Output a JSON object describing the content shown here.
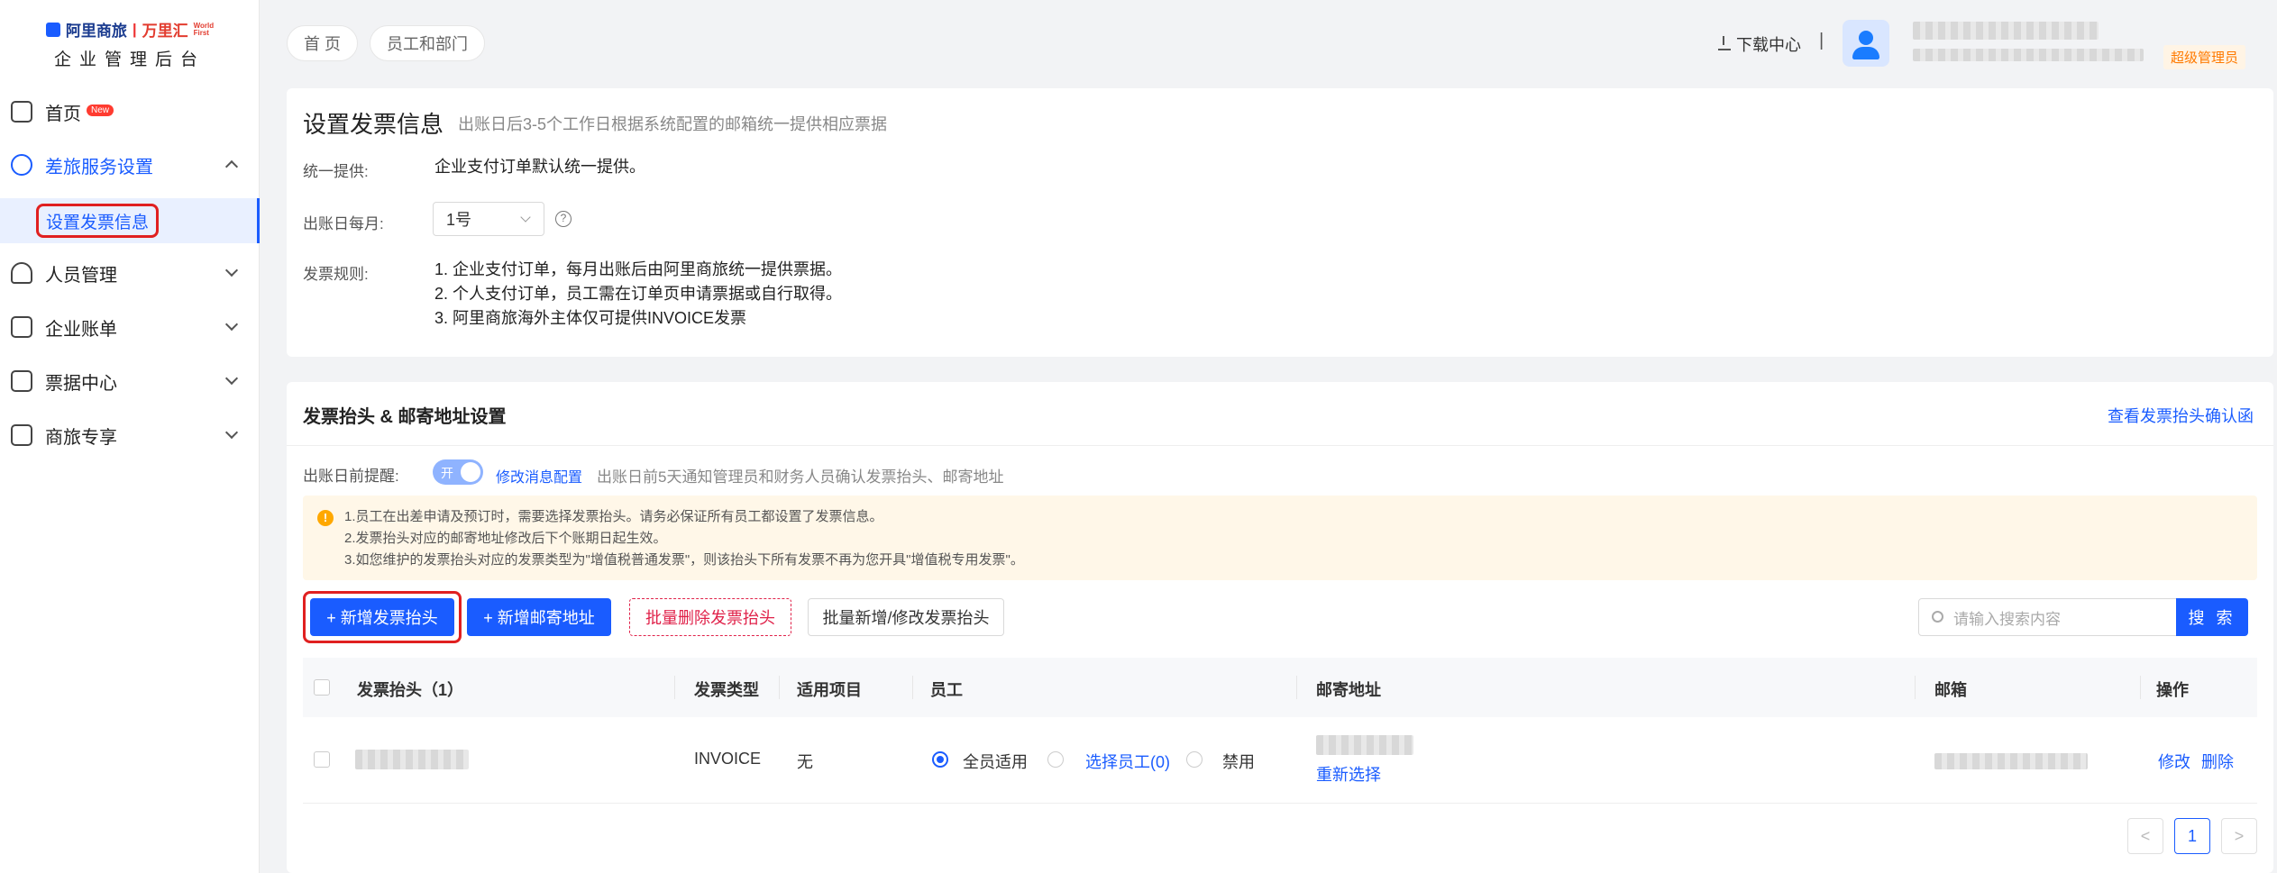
{
  "logo": {
    "brand1": "阿里商旅",
    "sep": "|",
    "brand2": "万里汇",
    "wf1": "World",
    "wf2": "First",
    "subtitle": "企业管理后台"
  },
  "sidebar": {
    "items": [
      {
        "label": "首页",
        "badge": "New"
      },
      {
        "label": "差旅服务设置",
        "sub": "设置发票信息"
      },
      {
        "label": "人员管理"
      },
      {
        "label": "企业账单"
      },
      {
        "label": "票据中心"
      },
      {
        "label": "商旅专享"
      }
    ]
  },
  "breadcrumb": [
    "首 页",
    "员工和部门"
  ],
  "header": {
    "download": "下载中心",
    "pipe": "|",
    "role": "超级管理员"
  },
  "invoice_info": {
    "title": "设置发票信息",
    "note": "出账日后3-5个工作日根据系统配置的邮箱统一提供相应票据",
    "unified_label": "统一提供:",
    "unified_value": "企业支付订单默认统一提供。",
    "billing_day_label": "出账日每月:",
    "billing_day_value": "1号",
    "help": "?",
    "rules_label": "发票规则:",
    "rules": [
      "1. 企业支付订单，每月出账后由阿里商旅统一提供票据。",
      "2. 个人支付订单，员工需在订单页申请票据或自行取得。",
      "3. 阿里商旅海外主体仅可提供INVOICE发票"
    ]
  },
  "header_setting": {
    "title": "发票抬头 & 邮寄地址设置",
    "confirm_link": "查看发票抬头确认函",
    "remind_label": "出账日前提醒:",
    "toggle_text": "开",
    "remind_link": "修改消息配置",
    "remind_note": "出账日前5天通知管理员和财务人员确认发票抬头、邮寄地址",
    "notice_icon": "!",
    "notices": [
      "1.员工在出差申请及预订时，需要选择发票抬头。请务必保证所有员工都设置了发票信息。",
      "2.发票抬头对应的邮寄地址修改后下个账期日起生效。",
      "3.如您维护的发票抬头对应的发票类型为\"增值税普通发票\"，则该抬头下所有发票不再为您开具\"增值税专用发票\"。"
    ],
    "buttons": {
      "add_header": "+ 新增发票抬头",
      "add_address": "+ 新增邮寄地址",
      "batch_delete": "批量删除发票抬头",
      "batch_edit": "批量新增/修改发票抬头"
    },
    "search": {
      "placeholder": "请输入搜索内容",
      "button": "搜 索"
    },
    "columns": [
      "发票抬头（1）",
      "发票类型",
      "适用项目",
      "员工",
      "邮寄地址",
      "邮箱",
      "操作"
    ],
    "row": {
      "type": "INVOICE",
      "project": "无",
      "emp_all": "全员适用",
      "emp_select": "选择员工(0)",
      "emp_disable": "禁用",
      "reselect": "重新选择",
      "edit": "修改",
      "delete": "删除"
    },
    "pagination": {
      "prev": "<",
      "page": "1",
      "next": ">"
    }
  }
}
